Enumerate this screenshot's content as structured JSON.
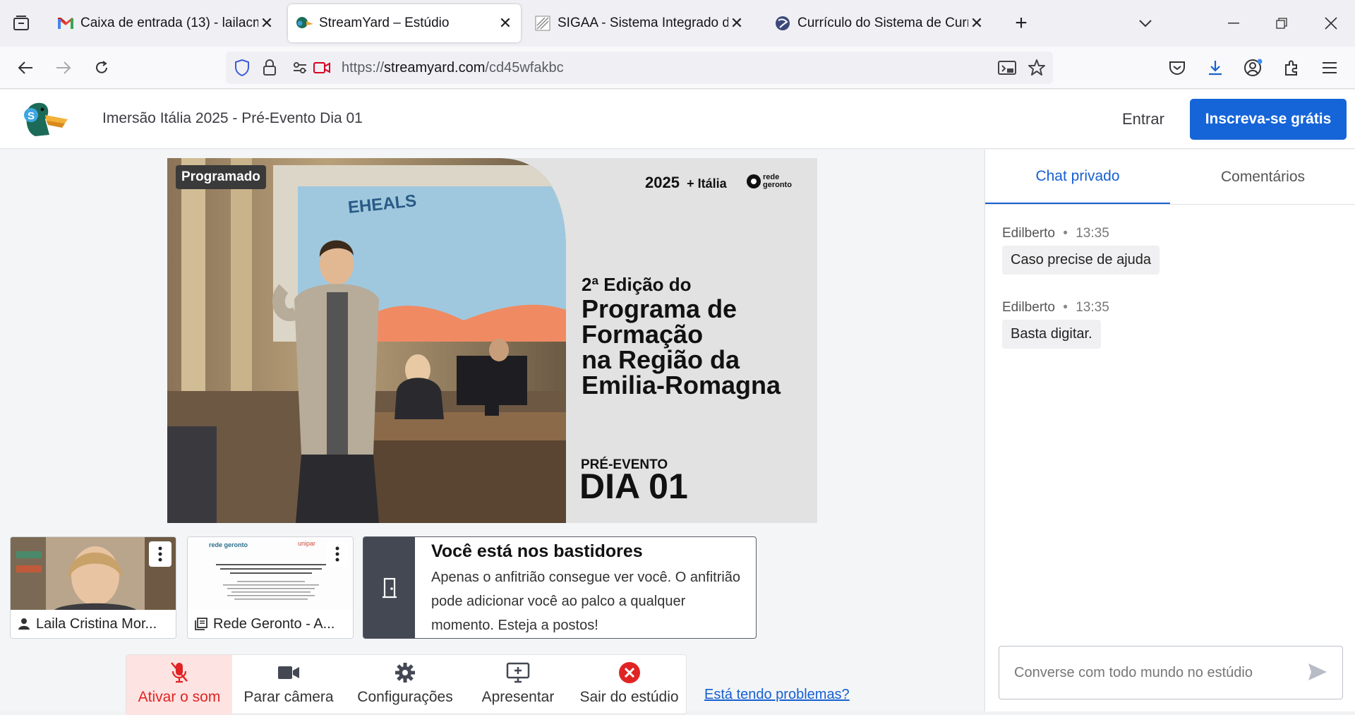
{
  "browser": {
    "tabs": [
      {
        "label": "Caixa de entrada (13) - lailacmd",
        "icon": "gmail-icon"
      },
      {
        "label": "StreamYard – Estúdio",
        "icon": "streamyard-icon"
      },
      {
        "label": "SIGAA - Sistema Integrado de G",
        "icon": "sigaa-icon"
      },
      {
        "label": "Currículo do Sistema de Currícu",
        "icon": "lattes-icon"
      }
    ],
    "url_prefix": "https://",
    "url_domain": "streamyard.com",
    "url_path": "/cd45wfakbc"
  },
  "header": {
    "title": "Imersão Itália 2025 - Pré-Evento Dia 01",
    "login": "Entrar",
    "signup": "Inscreva-se grátis"
  },
  "stage": {
    "badge": "Programado",
    "brand_year": "2025",
    "brand_country": "+ Itália",
    "brand_logo": "rede geronto",
    "slide_text": "EHEALS",
    "edition": "2ª Edição do",
    "title_lines": [
      "Programa de",
      "Formação",
      "na Região da",
      "Emilia-Romagna"
    ],
    "pre_event": "PRÉ-EVENTO",
    "day": "DIA 01"
  },
  "participants": [
    {
      "name": "Laila Cristina Mor..."
    },
    {
      "name": "Rede Geronto - A...",
      "doc_logo_left": "rede geronto",
      "doc_logo_right": "unipar"
    }
  ],
  "backstage": {
    "title": "Você está nos bastidores",
    "text": "Apenas o anfitrião consegue ver você. O anfitrião pode adicionar você ao palco a qualquer momento. Esteja a postos!"
  },
  "controls": {
    "mute": "Ativar o som",
    "camera": "Parar câmera",
    "settings": "Configurações",
    "present": "Apresentar",
    "leave": "Sair do estúdio",
    "problems": "Está tendo problemas?"
  },
  "chat": {
    "tabs": [
      "Chat privado",
      "Comentários"
    ],
    "messages": [
      {
        "author": "Edilberto",
        "time": "13:35",
        "text": "Caso precise de ajuda"
      },
      {
        "author": "Edilberto",
        "time": "13:35",
        "text": "Basta digitar."
      }
    ],
    "placeholder": "Converse com todo mundo no estúdio"
  },
  "colors": {
    "accent": "#1665d8",
    "mute_bg": "#fde3e1",
    "leave_red": "#e02424"
  }
}
